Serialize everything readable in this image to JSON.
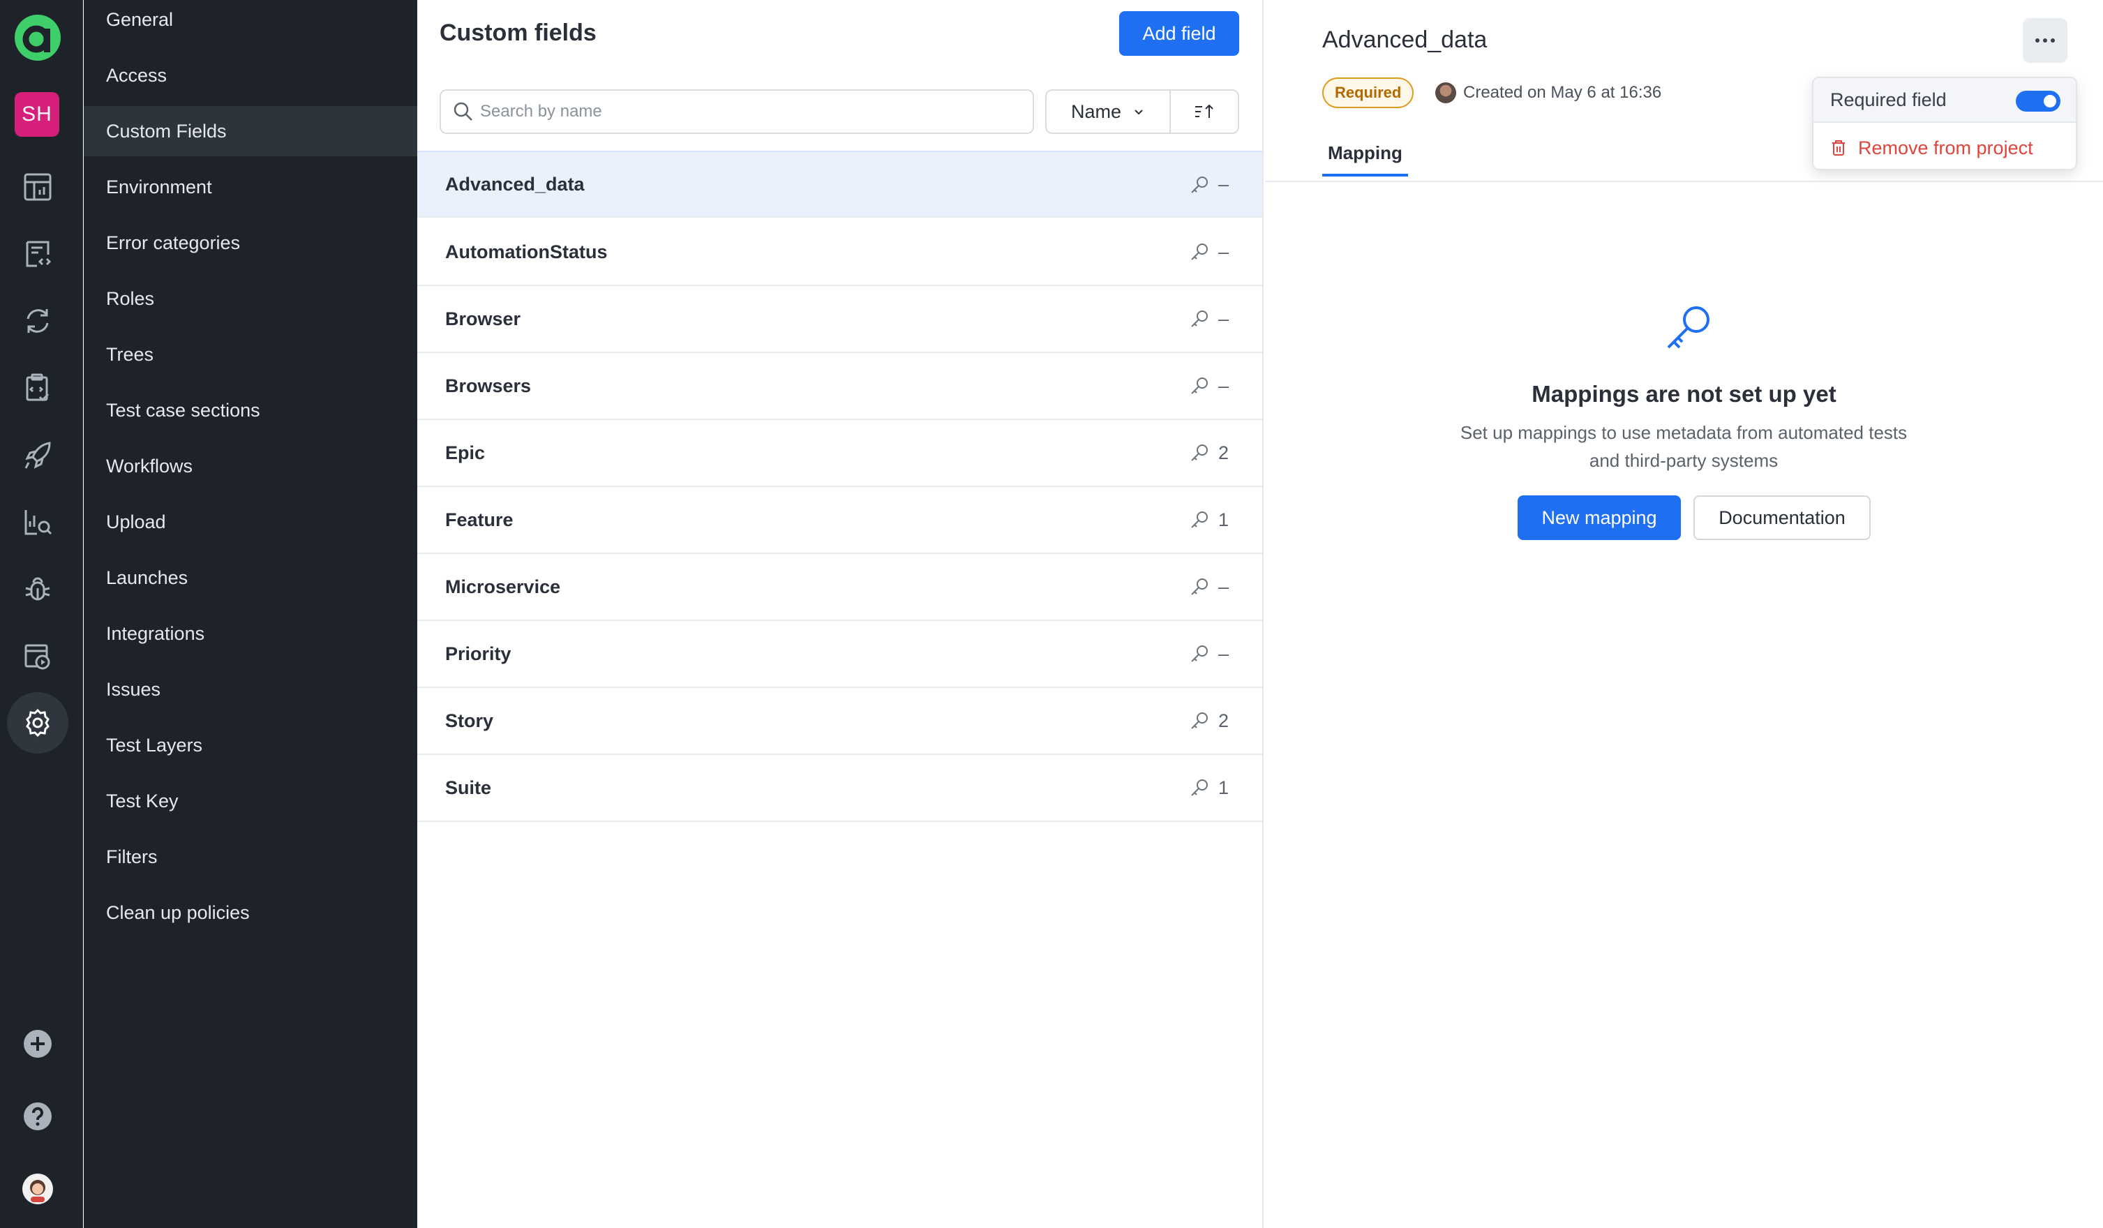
{
  "rail": {
    "project_initials": "SH",
    "icons": [
      "dashboard-icon",
      "test-cases-icon",
      "sync-icon",
      "test-plan-icon",
      "launches-icon",
      "analytics-icon",
      "bug-icon",
      "jobs-icon",
      "settings-icon",
      "add-icon",
      "help-icon",
      "user-avatar"
    ]
  },
  "nav": {
    "items": [
      {
        "label": "General"
      },
      {
        "label": "Access"
      },
      {
        "label": "Custom Fields"
      },
      {
        "label": "Environment"
      },
      {
        "label": "Error categories"
      },
      {
        "label": "Roles"
      },
      {
        "label": "Trees"
      },
      {
        "label": "Test case sections"
      },
      {
        "label": "Workflows"
      },
      {
        "label": "Upload"
      },
      {
        "label": "Launches"
      },
      {
        "label": "Integrations"
      },
      {
        "label": "Issues"
      },
      {
        "label": "Test Layers"
      },
      {
        "label": "Test Key"
      },
      {
        "label": "Filters"
      },
      {
        "label": "Clean up policies"
      }
    ],
    "active": "Custom Fields"
  },
  "list": {
    "title": "Custom fields",
    "add_button": "Add field",
    "search_placeholder": "Search by name",
    "sort_label": "Name",
    "rows": [
      {
        "name": "Advanced_data",
        "count": "–"
      },
      {
        "name": "AutomationStatus",
        "count": "–"
      },
      {
        "name": "Browser",
        "count": "–"
      },
      {
        "name": "Browsers",
        "count": "–"
      },
      {
        "name": "Epic",
        "count": "2"
      },
      {
        "name": "Feature",
        "count": "1"
      },
      {
        "name": "Microservice",
        "count": "–"
      },
      {
        "name": "Priority",
        "count": "–"
      },
      {
        "name": "Story",
        "count": "2"
      },
      {
        "name": "Suite",
        "count": "1"
      }
    ],
    "selected": "Advanced_data"
  },
  "detail": {
    "title": "Advanced_data",
    "badge": "Required",
    "created": "Created on May 6 at 16:36",
    "tab": "Mapping",
    "menu": {
      "required_label": "Required field",
      "required_on": true,
      "remove_label": "Remove from project"
    },
    "empty": {
      "title": "Mappings are not set up yet",
      "desc_line1": "Set up mappings to use metadata from automated tests",
      "desc_line2": "and third-party systems",
      "primary": "New mapping",
      "secondary": "Documentation"
    }
  },
  "colors": {
    "primary": "#1f6ff2",
    "sidebar": "#1d2329",
    "danger": "#e0443c",
    "badge": "#e09b1d",
    "brand": "#3ecf6b"
  }
}
